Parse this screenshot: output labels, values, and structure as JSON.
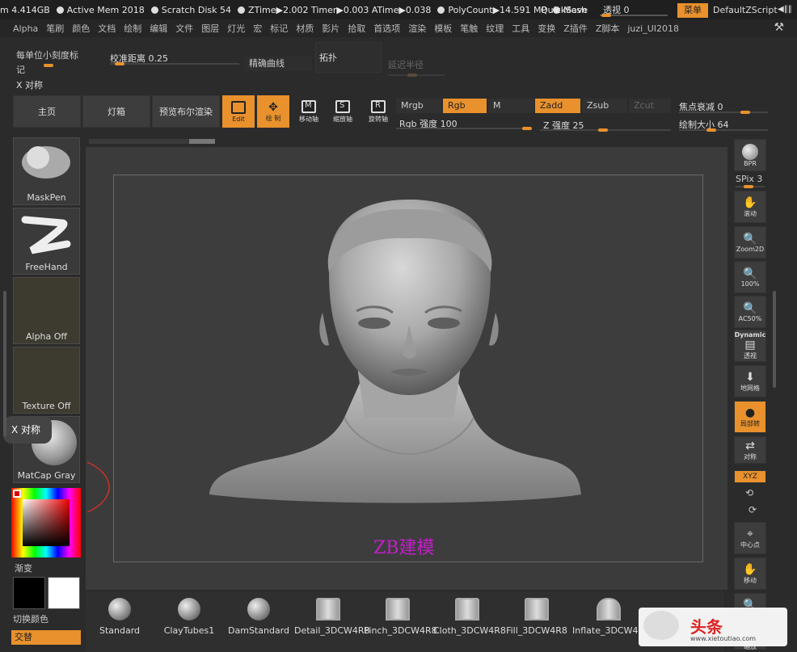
{
  "topbar": {
    "stats": [
      "m 4.414GB",
      "Active Mem 2018",
      "Scratch Disk 54",
      "ZTime▶2.002 Timer▶0.003 ATime▶0.038",
      "PolyCount▶14.591 MP",
      "Mesh"
    ],
    "quicksave": "QuickSave",
    "persp_label": "透视 0",
    "menu": "菜单",
    "default_zscript": "DefaultZScript",
    "right_glyph": "◀‖‖"
  },
  "menubar": {
    "items": [
      "Alpha",
      "笔刷",
      "颜色",
      "文档",
      "绘制",
      "编辑",
      "文件",
      "图层",
      "灯光",
      "宏",
      "标记",
      "材质",
      "影片",
      "拾取",
      "首选项",
      "渲染",
      "模板",
      "笔触",
      "纹理",
      "工具",
      "变换",
      "Z插件",
      "Z脚本",
      "juzi_UI2018"
    ]
  },
  "toolbar": {
    "per_unit": "每单位小刻度标记",
    "calib": "校准距离 0.25",
    "precise": "精确曲线",
    "topo": "拓扑",
    "delay": "延迟半径",
    "x_sym": "X 对称",
    "home": "主页",
    "lightbox": "灯箱",
    "preview_bool": "预览布尔渲染",
    "edit": "Edit",
    "draw": "绘 制",
    "move": "移动轴",
    "scale": "缩放轴",
    "rotate": "旋转轴",
    "mrgb": "Mrgb",
    "rgb": "Rgb",
    "m": "M",
    "zadd": "Zadd",
    "zsub": "Zsub",
    "zcut": "Zcut",
    "focal": "焦点衰减 0",
    "rgb_intensity": "Rgb 强度 100",
    "z_intensity": "Z 强度 25",
    "draw_size": "绘制大小 64"
  },
  "leftpanel": {
    "slots": [
      "MaskPen",
      "FreeHand",
      "Alpha Off",
      "Texture Off",
      "MatCap Gray"
    ],
    "tip": "X 对称",
    "gradient": "渐变",
    "switch_color": "切换颜色",
    "alternate": "交替"
  },
  "rightpanel": {
    "bpr": "BPR",
    "spix": "SPix 3",
    "scroll": "滚动",
    "zoom2d": "Zoom2D",
    "zoom100": "100%",
    "ac50": "AC50%",
    "dynamic": "Dynamic",
    "persp": "透视",
    "floor": "地网格",
    "local": "局部转",
    "sym": "对称",
    "xyz": "XYZ",
    "center": "中心点",
    "move": "移动",
    "zoom": "缩放"
  },
  "canvas": {
    "watermark": "ZB建模"
  },
  "brushes": [
    "Standard",
    "ClayTubes1",
    "DamStandard",
    "Detail_3DCW4R8",
    "Pinch_3DCW4R8",
    "Cloth_3DCW4R8",
    "Fill_3DCW4R8",
    "Inflate_3DCW4R8"
  ],
  "logo": {
    "name": "头条",
    "url": "www.xietoutiao.com"
  },
  "colors": {
    "accent": "#e8912d",
    "bg": "#2b2b2b",
    "watermark": "#c41ec8"
  }
}
